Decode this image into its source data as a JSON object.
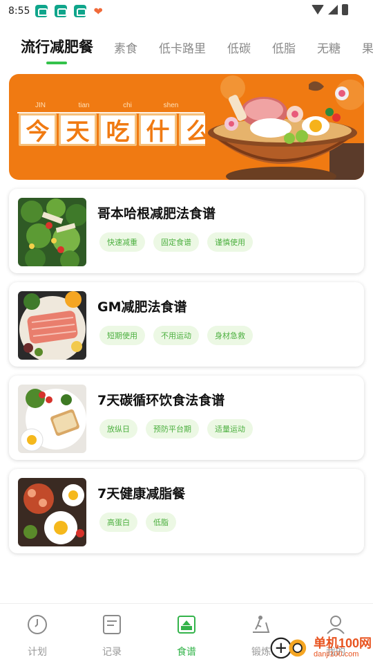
{
  "status_bar": {
    "time": "8:55",
    "notification_icons": [
      "app-notification-icon",
      "app-notification-icon",
      "app-notification-icon",
      "heart-icon"
    ],
    "system_icons": [
      "wifi-icon",
      "signal-icon",
      "battery-icon"
    ]
  },
  "tabs": [
    {
      "label": "流行减肥餐",
      "active": true
    },
    {
      "label": "素食",
      "active": false
    },
    {
      "label": "低卡路里",
      "active": false
    },
    {
      "label": "低碳",
      "active": false
    },
    {
      "label": "低脂",
      "active": false
    },
    {
      "label": "无糖",
      "active": false
    },
    {
      "label": "果汁",
      "active": false
    }
  ],
  "banner": {
    "pinyin": [
      "JIN",
      "tian",
      "chi",
      "shen",
      "me"
    ],
    "title_chars": [
      "今",
      "天",
      "吃",
      "什",
      "么"
    ],
    "colors": {
      "background": "#f07a12",
      "accent": "#ffffff"
    }
  },
  "recipes": [
    {
      "title": "哥本哈根减肥法食谱",
      "tags": [
        "快速减重",
        "固定食谱",
        "谨慎使用"
      ],
      "thumb": "salad-image"
    },
    {
      "title": "GM减肥法食谱",
      "tags": [
        "短期使用",
        "不用运动",
        "身材急救"
      ],
      "thumb": "salmon-image"
    },
    {
      "title": "7天碳循环饮食法食谱",
      "tags": [
        "放纵日",
        "预防平台期",
        "适量运动"
      ],
      "thumb": "breakfast-image"
    },
    {
      "title": "7天健康减脂餐",
      "tags": [
        "高蛋白",
        "低脂"
      ],
      "thumb": "eggs-image"
    }
  ],
  "bottom_nav": [
    {
      "label": "计划",
      "icon": "clock-icon",
      "active": false
    },
    {
      "label": "记录",
      "icon": "document-icon",
      "active": false
    },
    {
      "label": "食谱",
      "icon": "recipe-icon",
      "active": true
    },
    {
      "label": "锻炼",
      "icon": "treadmill-icon",
      "active": false
    },
    {
      "label": "我的",
      "icon": "user-icon",
      "active": false
    }
  ],
  "watermark": {
    "main": "单机100网",
    "sub": "danji100.com"
  },
  "colors": {
    "accent_green": "#33c24a",
    "tag_bg": "#ecf8e4",
    "tag_text": "#4caf3f"
  }
}
